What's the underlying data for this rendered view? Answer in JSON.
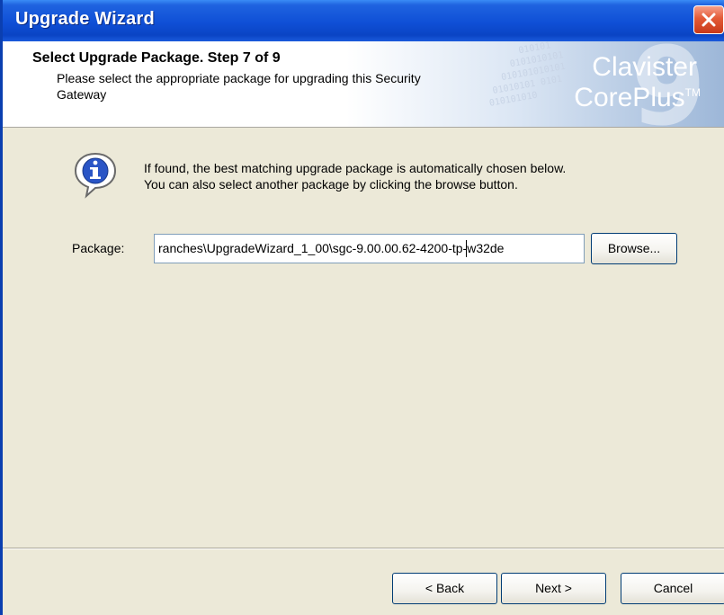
{
  "window": {
    "title": "Upgrade Wizard"
  },
  "header": {
    "step_title": "Select Upgrade Package. Step 7 of 9",
    "step_desc": "Please select the appropriate package for upgrading this Security Gateway",
    "brand_line1": "Clavister",
    "brand_line2": "CorePlus",
    "brand_tm": "TM"
  },
  "info": {
    "line1": "If found, the best matching upgrade package is automatically chosen below.",
    "line2": "You can also select another package by clicking the browse button."
  },
  "package": {
    "label": "Package:",
    "value": "ranches\\UpgradeWizard_1_00\\sgc-9.00.00.62-4200-tp-w32de",
    "browse_label": "Browse..."
  },
  "footer": {
    "back_label": "< Back",
    "next_label": "Next >",
    "cancel_label": "Cancel"
  },
  "colors": {
    "titlebar": "#0f4fd6",
    "close": "#e35a36",
    "dialog_bg": "#ece9d8"
  }
}
